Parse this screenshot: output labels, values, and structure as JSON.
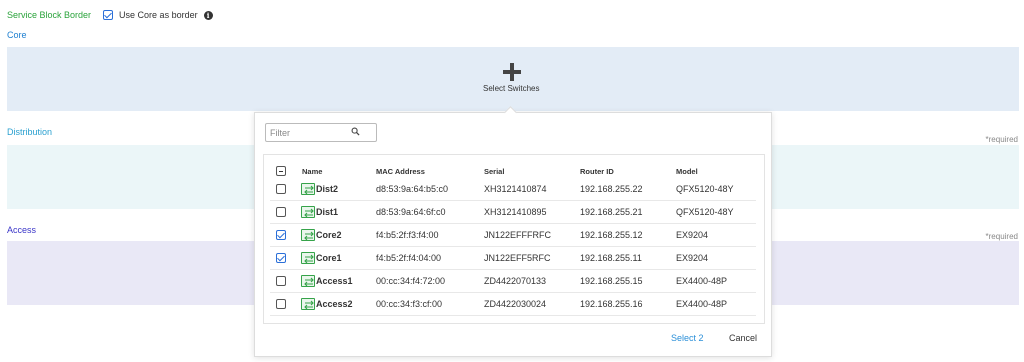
{
  "top": {
    "service_block_label": "Service Block Border",
    "use_core_label": "Use Core as border",
    "use_core_checked": true
  },
  "sections": {
    "core_label": "Core",
    "distribution_label": "Distribution",
    "access_label": "Access",
    "required_text": "*required"
  },
  "core_zone": {
    "select_switches_label": "Select Switches"
  },
  "popover": {
    "filter_placeholder": "Filter",
    "columns": [
      "Name",
      "MAC Address",
      "Serial",
      "Router ID",
      "Model"
    ],
    "rows": [
      {
        "name": "Dist2",
        "mac": "d8:53:9a:64:b5:c0",
        "serial": "XH3121410874",
        "router_id": "192.168.255.22",
        "model": "QFX5120-48Y",
        "checked": false
      },
      {
        "name": "Dist1",
        "mac": "d8:53:9a:64:6f:c0",
        "serial": "XH3121410895",
        "router_id": "192.168.255.21",
        "model": "QFX5120-48Y",
        "checked": false
      },
      {
        "name": "Core2",
        "mac": "f4:b5:2f:f3:f4:00",
        "serial": "JN122EFFFRFC",
        "router_id": "192.168.255.12",
        "model": "EX9204",
        "checked": true
      },
      {
        "name": "Core1",
        "mac": "f4:b5:2f:f4:04:00",
        "serial": "JN122EFF5RFC",
        "router_id": "192.168.255.11",
        "model": "EX9204",
        "checked": true
      },
      {
        "name": "Access1",
        "mac": "00:cc:34:f4:72:00",
        "serial": "ZD4422070133",
        "router_id": "192.168.255.15",
        "model": "EX4400-48P",
        "checked": false
      },
      {
        "name": "Access2",
        "mac": "00:cc:34:f3:cf:00",
        "serial": "ZD4422030024",
        "router_id": "192.168.255.16",
        "model": "EX4400-48P",
        "checked": false
      }
    ],
    "select_button_label": "Select 2",
    "cancel_button_label": "Cancel"
  },
  "icons": {
    "info": "info-icon",
    "search": "search-icon",
    "switch": "switch-icon",
    "add": "plus-icon"
  },
  "colors": {
    "service_block_green": "#2aa33b",
    "core_blue": "#1e7fd0",
    "distribution_teal": "#2aa0d0",
    "access_indigo": "#3a35c8",
    "link_blue": "#2b8fd8",
    "switch_green": "#36a34a"
  }
}
